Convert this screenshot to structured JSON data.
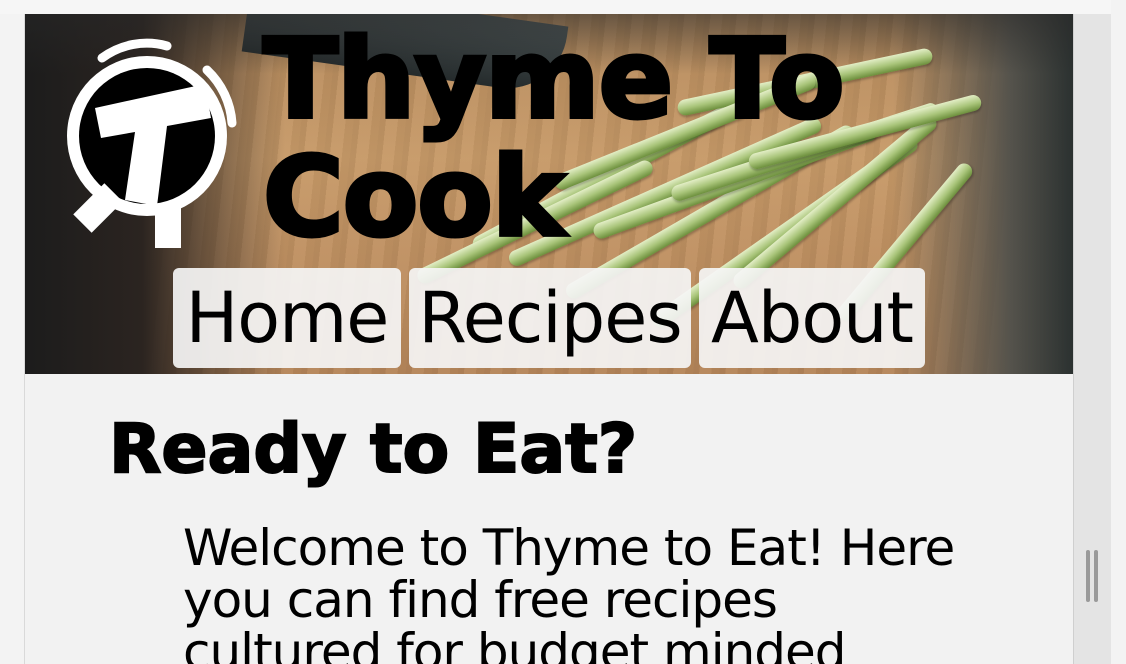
{
  "site": {
    "title_line1": "Thyme To",
    "title_line2": "Cook"
  },
  "nav": {
    "items": [
      {
        "label": "Home"
      },
      {
        "label": "Recipes"
      },
      {
        "label": "About"
      }
    ]
  },
  "main": {
    "heading": "Ready to Eat?",
    "intro_line1": "Welcome to Thyme to Eat! Here",
    "intro_line2": "you can find free recipes",
    "intro_line3": "cultured for budget minded"
  },
  "colors": {
    "text": "#000000",
    "page_background": "#f2f2f2",
    "nav_button_background": "#f5f5f5"
  },
  "icons": {
    "logo": "timer-t-logo-icon"
  }
}
